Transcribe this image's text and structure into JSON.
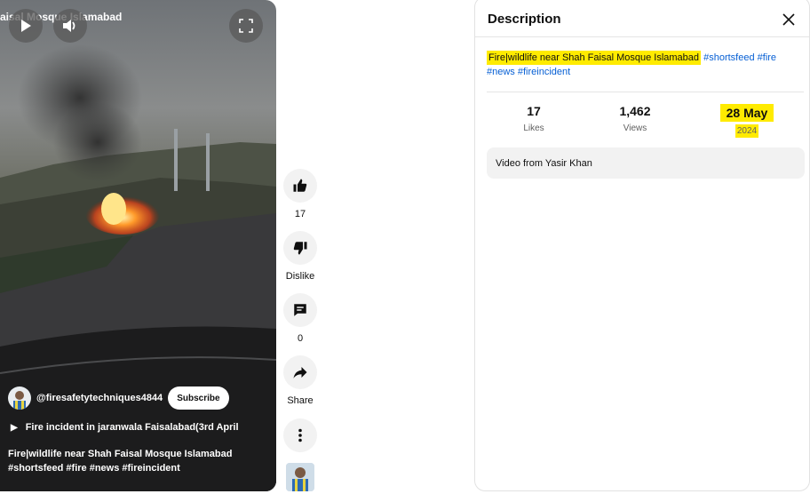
{
  "player": {
    "title": "aisal Mosque Islamabad",
    "channel_name": "@firesafetytechniques4844",
    "subscribe_label": "Subscribe",
    "playlist_label": "Fire incident in jaranwala Faisalabad(3rd April",
    "description": "Fire|wildlife near Shah Faisal Mosque Islamabad #shortsfeed #fire #news #fireincident",
    "icons": {
      "play": "play-icon",
      "volume": "volume-icon",
      "fullscreen": "fullscreen-icon"
    }
  },
  "actions": {
    "like_count": "17",
    "dislike_label": "Dislike",
    "comment_count": "0",
    "share_label": "Share",
    "icons": [
      "thumbs-up-icon",
      "thumbs-down-icon",
      "comment-icon",
      "share-icon",
      "more-vertical-icon"
    ]
  },
  "description_panel": {
    "header": "Description",
    "text_main": "Fire|wildlife near Shah Faisal Mosque Islamabad",
    "tags": [
      "#shortsfeed",
      "#fire",
      "#news",
      "#fireincident"
    ],
    "stats": [
      {
        "value": "17",
        "label": "Likes"
      },
      {
        "value": "1,462",
        "label": "Views"
      },
      {
        "value": "28 May",
        "label": "2024"
      }
    ],
    "video_from": "Video from Yasir Khan"
  },
  "colors": {
    "highlight": "#ffeb00",
    "link": "#065fd4",
    "button_bg": "#f2f2f2"
  }
}
